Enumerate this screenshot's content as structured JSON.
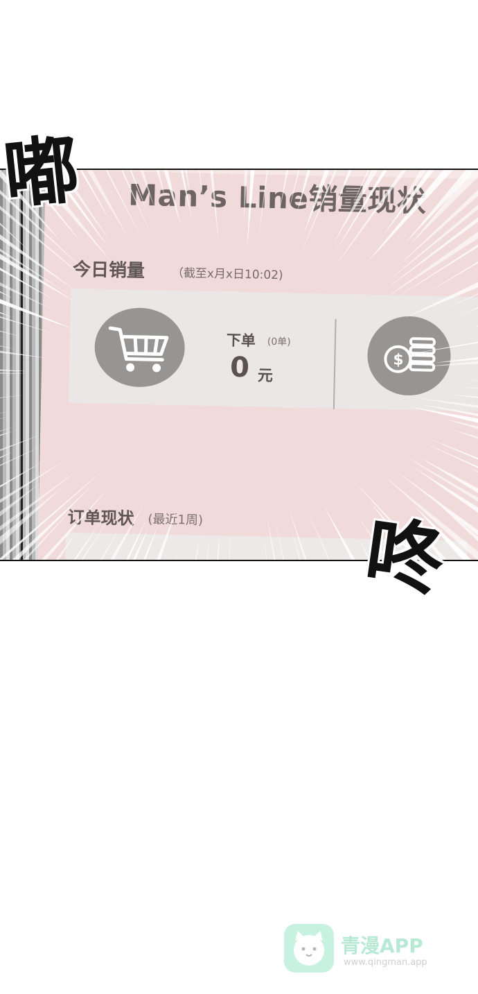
{
  "sfx": {
    "left": "嘟",
    "right": "咚"
  },
  "screen": {
    "title": "Man’s Line销量现状",
    "today_label": "今日销量",
    "today_note": "（截至x月x日10:02)",
    "order_label": "下单",
    "order_count": "(0单)",
    "order_value": "0",
    "order_unit": "元",
    "status_label": "订单现状",
    "status_range": "(最近1周)"
  },
  "watermark": {
    "name": "青漫APP",
    "url": "www.qingman.app"
  }
}
